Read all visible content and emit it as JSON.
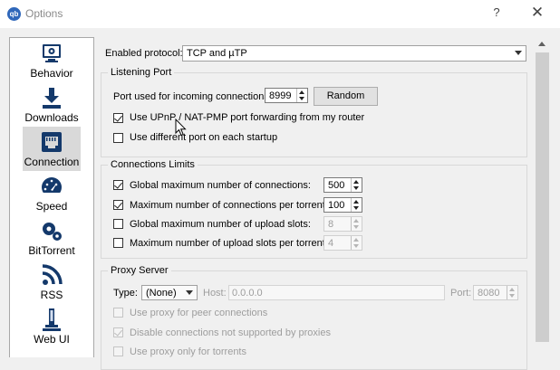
{
  "window": {
    "title": "Options",
    "app_icon": "qb",
    "help": "?",
    "close": "✕"
  },
  "sidebar": {
    "items": [
      {
        "label": "Behavior",
        "icon": "behavior-icon",
        "selected": false
      },
      {
        "label": "Downloads",
        "icon": "downloads-icon",
        "selected": false
      },
      {
        "label": "Connection",
        "icon": "connection-icon",
        "selected": true
      },
      {
        "label": "Speed",
        "icon": "speed-icon",
        "selected": false
      },
      {
        "label": "BitTorrent",
        "icon": "bittorrent-icon",
        "selected": false
      },
      {
        "label": "RSS",
        "icon": "rss-icon",
        "selected": false
      },
      {
        "label": "Web UI",
        "icon": "webui-icon",
        "selected": false
      }
    ]
  },
  "protocol": {
    "label": "Enabled protocol:",
    "value": "TCP and µTP"
  },
  "listening": {
    "title": "Listening Port",
    "port_label": "Port used for incoming connections:",
    "port_value": "8999",
    "random_button": "Random",
    "upnp_label": "Use UPnP / NAT-PMP port forwarding from my router",
    "upnp_checked": true,
    "diff_port_label": "Use different port on each startup",
    "diff_port_checked": false
  },
  "limits": {
    "title": "Connections Limits",
    "rows": [
      {
        "label": "Global maximum number of connections:",
        "checked": true,
        "value": "500",
        "enabled": true
      },
      {
        "label": "Maximum number of connections per torrent:",
        "checked": true,
        "value": "100",
        "enabled": true
      },
      {
        "label": "Global maximum number of upload slots:",
        "checked": false,
        "value": "8",
        "enabled": false
      },
      {
        "label": "Maximum number of upload slots per torrent:",
        "checked": false,
        "value": "4",
        "enabled": false
      }
    ]
  },
  "proxy": {
    "title": "Proxy Server",
    "type_label": "Type:",
    "type_value": "(None)",
    "host_label": "Host:",
    "host_value": "0.0.0.0",
    "port_label": "Port:",
    "port_value": "8080",
    "opt_peer": "Use proxy for peer connections",
    "opt_disable": "Disable connections not supported by proxies",
    "opt_torrents": "Use proxy only for torrents"
  },
  "colors": {
    "selected_bg": "#d9d9d9",
    "disabled_text": "#9d9d9d",
    "app_icon_blue": "#2f67ba"
  }
}
